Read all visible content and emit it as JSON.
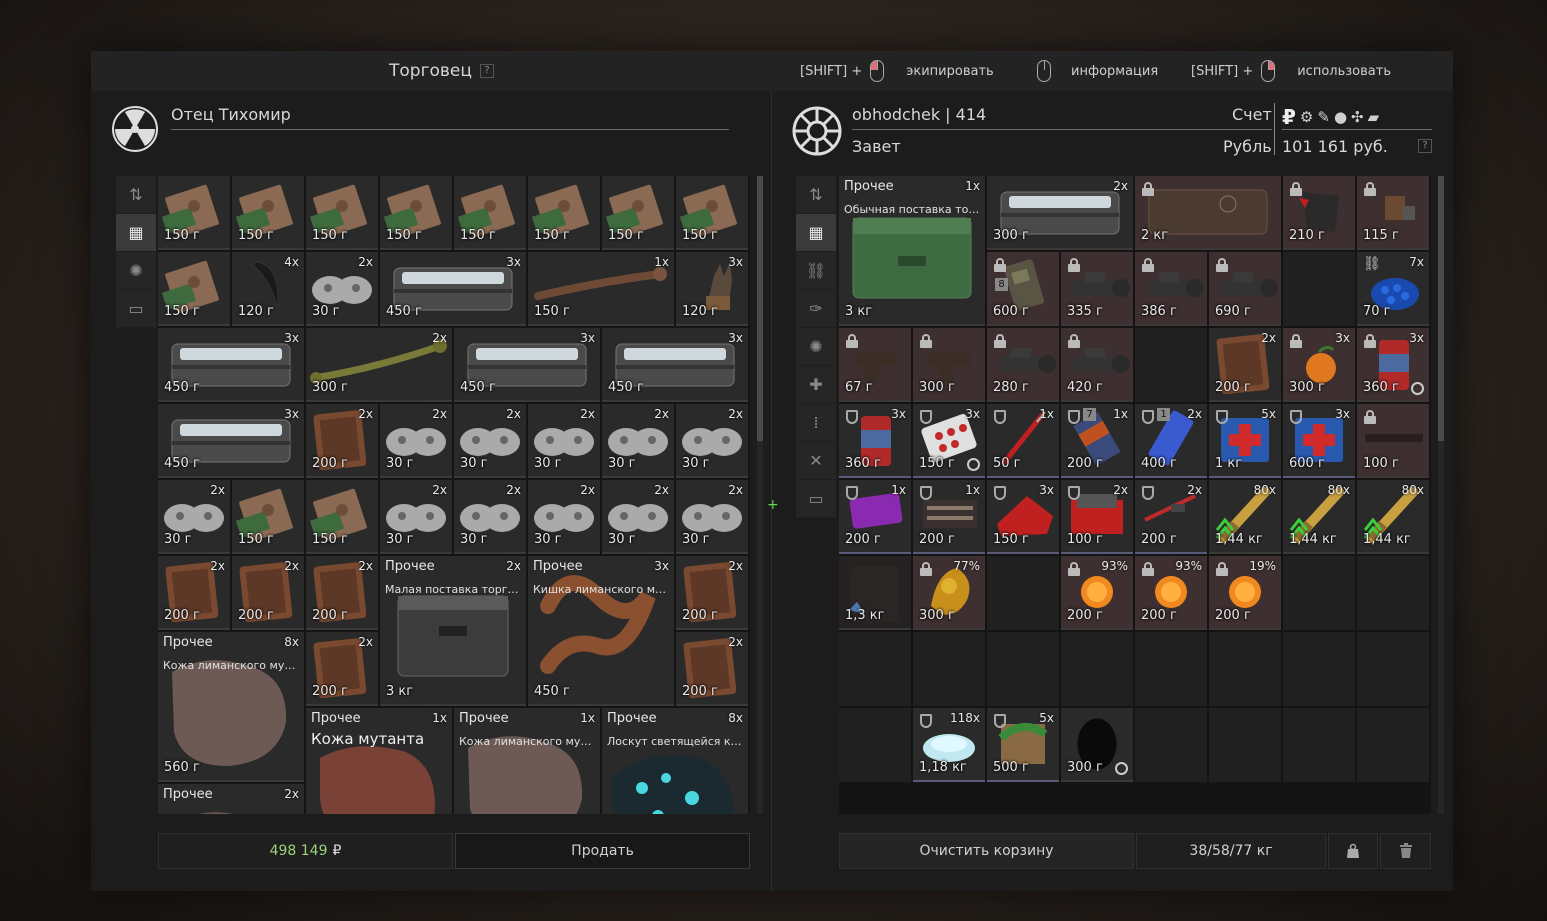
{
  "header": {
    "title": "Торговец",
    "hint1_key": "[SHIFT] +",
    "hint1_label": "экипировать",
    "hint2_label": "информация",
    "hint3_key": "[SHIFT] +",
    "hint3_label": "использовать",
    "help": "?"
  },
  "trader": {
    "name": "Отец Тихомир"
  },
  "player": {
    "name": "obhodchek",
    "separator": "|",
    "level": "414",
    "faction": "Завет",
    "account_label": "Счет",
    "currency_label": "Рубль",
    "balance": "101 161 руб.",
    "currency_symbol": "₽"
  },
  "left_footer": {
    "total": "498 149",
    "total_symbol": "₽",
    "sell_label": "Продать"
  },
  "right_footer": {
    "clear_label": "Очистить корзину",
    "weight": "38/58/77 кг"
  },
  "left_items": [
    {
      "p": "150 г",
      "t": "board"
    },
    {
      "p": "150 г",
      "t": "board"
    },
    {
      "p": "150 г",
      "t": "board"
    },
    {
      "p": "150 г",
      "t": "board"
    },
    {
      "p": "150 г",
      "t": "board"
    },
    {
      "p": "150 г",
      "t": "board"
    },
    {
      "p": "150 г",
      "t": "board"
    },
    {
      "p": "150 г",
      "t": "board"
    },
    {
      "p": "150 г",
      "t": "board"
    },
    {
      "p": "120 г",
      "q": "4x",
      "t": "horn"
    },
    {
      "p": "30 г",
      "q": "2x",
      "t": "pad"
    },
    {
      "p": "450 г",
      "q": "3x",
      "t": "tin",
      "w": 2
    },
    {
      "p": "150 г",
      "q": "1x",
      "t": "bone",
      "w": 2
    },
    {
      "p": "120 г",
      "q": "3x",
      "t": "claw"
    },
    {
      "p": "450 г",
      "q": "3x",
      "t": "tin",
      "w": 2
    },
    {
      "p": "300 г",
      "q": "2x",
      "t": "greenbone",
      "w": 2
    },
    {
      "p": "450 г",
      "q": "3x",
      "t": "tin",
      "w": 2
    },
    {
      "p": "450 г",
      "q": "3x",
      "t": "tin",
      "w": 2
    },
    {
      "p": "450 г",
      "q": "3x",
      "t": "tin",
      "w": 2
    },
    {
      "p": "200 г",
      "q": "2x",
      "t": "hide"
    },
    {
      "p": "30 г",
      "q": "2x",
      "t": "pad"
    },
    {
      "p": "30 г",
      "q": "2x",
      "t": "pad"
    },
    {
      "p": "30 г",
      "q": "2x",
      "t": "pad"
    },
    {
      "p": "30 г",
      "q": "2x",
      "t": "pad"
    },
    {
      "p": "30 г",
      "q": "2x",
      "t": "pad"
    },
    {
      "p": "30 г",
      "q": "2x",
      "t": "pad"
    },
    {
      "p": "150 г",
      "t": "board"
    },
    {
      "p": "150 г",
      "t": "board"
    },
    {
      "p": "30 г",
      "q": "2x",
      "t": "pad"
    },
    {
      "p": "30 г",
      "q": "2x",
      "t": "pad"
    },
    {
      "p": "30 г",
      "q": "2x",
      "t": "pad"
    },
    {
      "p": "30 г",
      "q": "2x",
      "t": "pad"
    },
    {
      "p": "30 г",
      "q": "2x",
      "t": "pad"
    },
    {
      "p": "200 г",
      "q": "2x",
      "t": "hide"
    },
    {
      "p": "200 г",
      "q": "2x",
      "t": "hide"
    },
    {
      "p": "200 г",
      "q": "2x",
      "t": "hide"
    },
    {
      "p": "3 кг",
      "q": "2x",
      "t": "box",
      "w": 2,
      "h": 2,
      "cat": "Прочее",
      "sub": "Малая поставка торгов.."
    },
    {
      "p": "450 г",
      "q": "3x",
      "t": "sausage",
      "w": 2,
      "h": 2,
      "cat": "Прочее",
      "sub": "Кишка лиманского мут.."
    },
    {
      "p": "200 г",
      "q": "2x",
      "t": "hide"
    },
    {
      "p": "560 г",
      "q": "8x",
      "t": "skin",
      "w": 2,
      "h": 2,
      "cat": "Прочее",
      "sub": "Кожа лиманского мутан.."
    },
    {
      "p": "200 г",
      "q": "2x",
      "t": "hide"
    },
    {
      "p": "200 г",
      "q": "2x",
      "t": "hide"
    },
    {
      "p": "",
      "q": "1x",
      "t": "redskin",
      "w": 2,
      "h": 2,
      "cat": "Прочее",
      "big": "Кожа мутанта"
    },
    {
      "p": "",
      "q": "1x",
      "t": "skin",
      "w": 2,
      "h": 2,
      "cat": "Прочее",
      "sub": "Кожа лиманского мутан.."
    },
    {
      "p": "",
      "q": "8x",
      "t": "glow",
      "w": 2,
      "h": 2,
      "cat": "Прочее",
      "sub": "Лоскут светящейся кож.."
    },
    {
      "p": "",
      "q": "2x",
      "t": "skin",
      "w": 2,
      "cat": "Прочее"
    }
  ],
  "right_items": [
    {
      "p": "3 кг",
      "q": "1x",
      "t": "greenbox",
      "w": 2,
      "h": 2,
      "cat": "Прочее",
      "sub": "Обычная поставка торг.."
    },
    {
      "p": "300 г",
      "q": "2x",
      "t": "tin",
      "w": 2
    },
    {
      "p": "2 кг",
      "t": "case",
      "w": 2,
      "l": 1
    },
    {
      "p": "210 г",
      "t": "glove",
      "l": 1
    },
    {
      "p": "115 г",
      "t": "misc",
      "l": 1
    },
    {
      "p": "600 г",
      "t": "radio",
      "l": 1,
      "badge": "8"
    },
    {
      "p": "335 г",
      "t": "scope",
      "l": 1
    },
    {
      "p": "386 г",
      "t": "scope",
      "l": 1
    },
    {
      "p": "690 г",
      "t": "scope",
      "l": 1
    },
    {
      "e": 1
    },
    {
      "p": "70 г",
      "q": "7x",
      "t": "blue",
      "link": 1
    },
    {
      "p": "67 г",
      "t": "grip",
      "l": 1
    },
    {
      "p": "300 г",
      "t": "grip",
      "l": 1
    },
    {
      "p": "280 г",
      "t": "scope",
      "l": 1
    },
    {
      "p": "420 г",
      "t": "scope",
      "l": 1
    },
    {
      "e": 1
    },
    {
      "p": "200 г",
      "q": "2x",
      "t": "hide"
    },
    {
      "p": "300 г",
      "q": "3x",
      "t": "orange",
      "l": 1
    },
    {
      "p": "360 г",
      "q": "3x",
      "t": "can",
      "l": 1,
      "clock": 1
    },
    {
      "p": "360 г",
      "q": "3x",
      "t": "can",
      "s": 1
    },
    {
      "p": "150 г",
      "q": "3x",
      "t": "pills",
      "s": 1,
      "clock": 1
    },
    {
      "p": "50 г",
      "q": "1x",
      "t": "syringe",
      "s": 1
    },
    {
      "p": "200 г",
      "q": "1x",
      "t": "pack",
      "s": 1,
      "badge": "7"
    },
    {
      "p": "400 г",
      "q": "2x",
      "t": "bluepack",
      "s": 1,
      "badge": "1"
    },
    {
      "p": "1 кг",
      "q": "5x",
      "t": "medkit",
      "s": 1
    },
    {
      "p": "600 г",
      "q": "3x",
      "t": "medkit",
      "s": 1
    },
    {
      "p": "100 г",
      "t": "stick",
      "l": 1
    },
    {
      "p": "200 г",
      "q": "1x",
      "t": "purple",
      "s": 1
    },
    {
      "p": "200 г",
      "q": "1x",
      "t": "kit",
      "s": 1
    },
    {
      "p": "150 г",
      "q": "3x",
      "t": "redcloth",
      "s": 1
    },
    {
      "p": "100 г",
      "q": "2x",
      "t": "redbox",
      "s": 1
    },
    {
      "p": "200 г",
      "q": "2x",
      "t": "tourniquet",
      "s": 1
    },
    {
      "p": "1,44 кг",
      "q": "80x",
      "t": "ammo"
    },
    {
      "p": "1,44 кг",
      "q": "80x",
      "t": "ammo"
    },
    {
      "p": "1,44 кг",
      "q": "80x",
      "t": "ammo"
    },
    {
      "p": "1,3 кг",
      "t": "bag",
      "dark": 1
    },
    {
      "p": "300 г",
      "q": "77%",
      "t": "gold",
      "l": 1
    },
    {
      "e": 1
    },
    {
      "p": "200 г",
      "q": "93%",
      "t": "fire",
      "l": 1
    },
    {
      "p": "200 г",
      "q": "93%",
      "t": "fire",
      "l": 1
    },
    {
      "p": "200 г",
      "q": "19%",
      "t": "fire",
      "l": 1
    },
    {
      "e": 1
    },
    {
      "e": 1
    },
    {
      "e": 1
    },
    {
      "e": 1
    },
    {
      "e": 1
    },
    {
      "e": 1
    },
    {
      "e": 1
    },
    {
      "e": 1
    },
    {
      "e": 1
    },
    {
      "e": 1
    },
    {
      "e": 1
    },
    {
      "p": "1,18 кг",
      "q": "118x",
      "t": "salt",
      "s": 1
    },
    {
      "p": "500 г",
      "q": "5x",
      "t": "crate",
      "s": 1
    },
    {
      "p": "300 г",
      "t": "black",
      "clock": 1
    },
    {
      "e": 1
    },
    {
      "e": 1
    },
    {
      "e": 1
    },
    {
      "e": 1
    }
  ],
  "left_sidebar": [
    "sort-icon",
    "grid-icon",
    "artifact-icon",
    "storage-icon"
  ],
  "right_sidebar": [
    "sort-icon",
    "grid-icon",
    "link-icon",
    "knife-icon",
    "artifact-icon",
    "medkit-icon",
    "ammo-icon",
    "tools-icon",
    "storage-icon"
  ],
  "colors": {
    "accent_green": "#9bd27a",
    "locked_bg": "#3e2f30"
  }
}
